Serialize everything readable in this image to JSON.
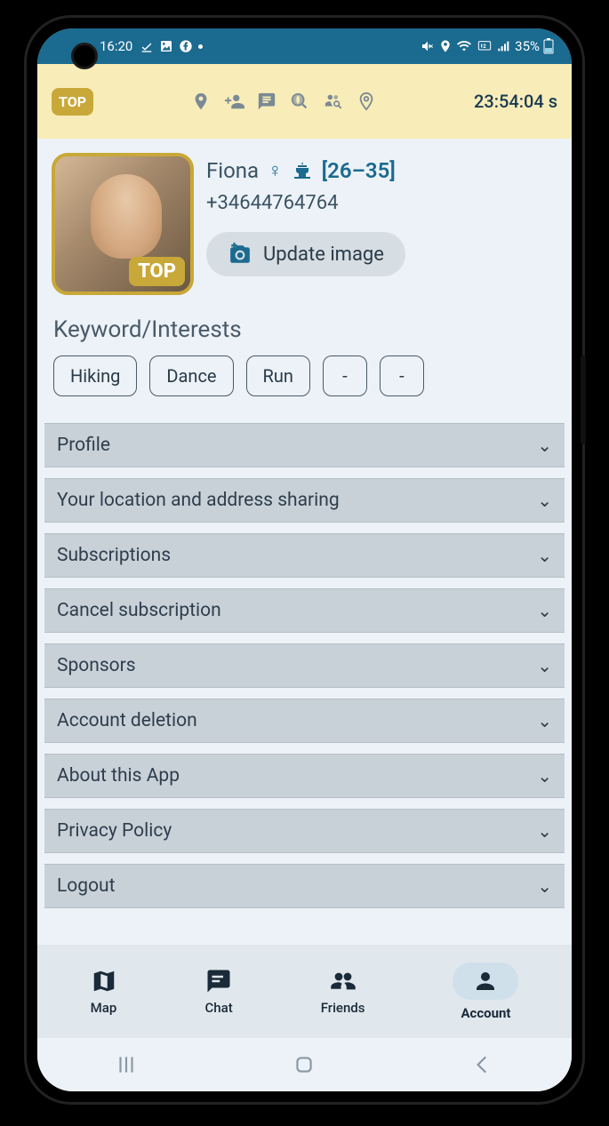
{
  "status_bar": {
    "time": "16:20",
    "battery": "35%"
  },
  "header": {
    "badge": "TOP",
    "timer": "23:54:04 s"
  },
  "profile": {
    "name": "Fiona",
    "age_range": "[26–35]",
    "phone": "+34644764764",
    "avatar_badge": "TOP",
    "update_btn": "Update image"
  },
  "interests": {
    "title": "Keyword/Interests",
    "chips": [
      "Hiking",
      "Dance",
      "Run",
      "-",
      "-"
    ]
  },
  "accordion": [
    "Profile",
    "Your location and address sharing",
    "Subscriptions",
    "Cancel subscription",
    "Sponsors",
    "Account deletion",
    "About this App",
    "Privacy Policy",
    "Logout"
  ],
  "bottom_nav": {
    "items": [
      {
        "label": "Map",
        "icon": "map"
      },
      {
        "label": "Chat",
        "icon": "chat"
      },
      {
        "label": "Friends",
        "icon": "friends"
      },
      {
        "label": "Account",
        "icon": "account"
      }
    ],
    "active": 3
  }
}
